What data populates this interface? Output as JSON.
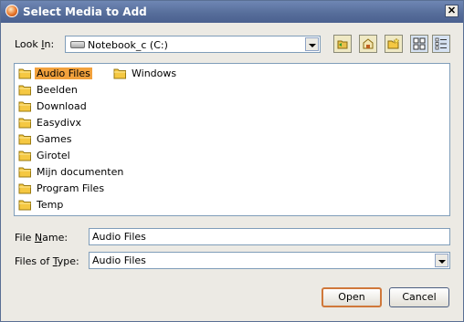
{
  "dialog": {
    "title": "Select Media to Add"
  },
  "look_in": {
    "label": "Look In:",
    "label_underline": "I",
    "value": "Notebook_c (C:)"
  },
  "toolbar": [
    {
      "name": "go-back-icon"
    },
    {
      "name": "up-one-level-icon"
    },
    {
      "name": "new-folder-icon"
    },
    {
      "name": "list-view-icon"
    },
    {
      "name": "details-view-icon"
    }
  ],
  "files": [
    {
      "label": "Audio Files",
      "selected": true
    },
    {
      "label": "Beelden"
    },
    {
      "label": "Download"
    },
    {
      "label": "Easydivx"
    },
    {
      "label": "Games"
    },
    {
      "label": "Girotel"
    },
    {
      "label": "Mijn documenten"
    },
    {
      "label": "Program Files"
    },
    {
      "label": "Temp"
    },
    {
      "label": "Windows"
    }
  ],
  "file_name": {
    "label_pre": "File ",
    "label_u": "N",
    "label_post": "ame:",
    "value": "Audio Files"
  },
  "file_type": {
    "label_pre": "Files of ",
    "label_u": "T",
    "label_post": "ype:",
    "value": "Audio Files"
  },
  "buttons": {
    "open": "Open",
    "cancel": "Cancel"
  },
  "colors": {
    "title_bar": "#556c99",
    "selection": "#f2a13c",
    "folder": "#f5c842"
  }
}
